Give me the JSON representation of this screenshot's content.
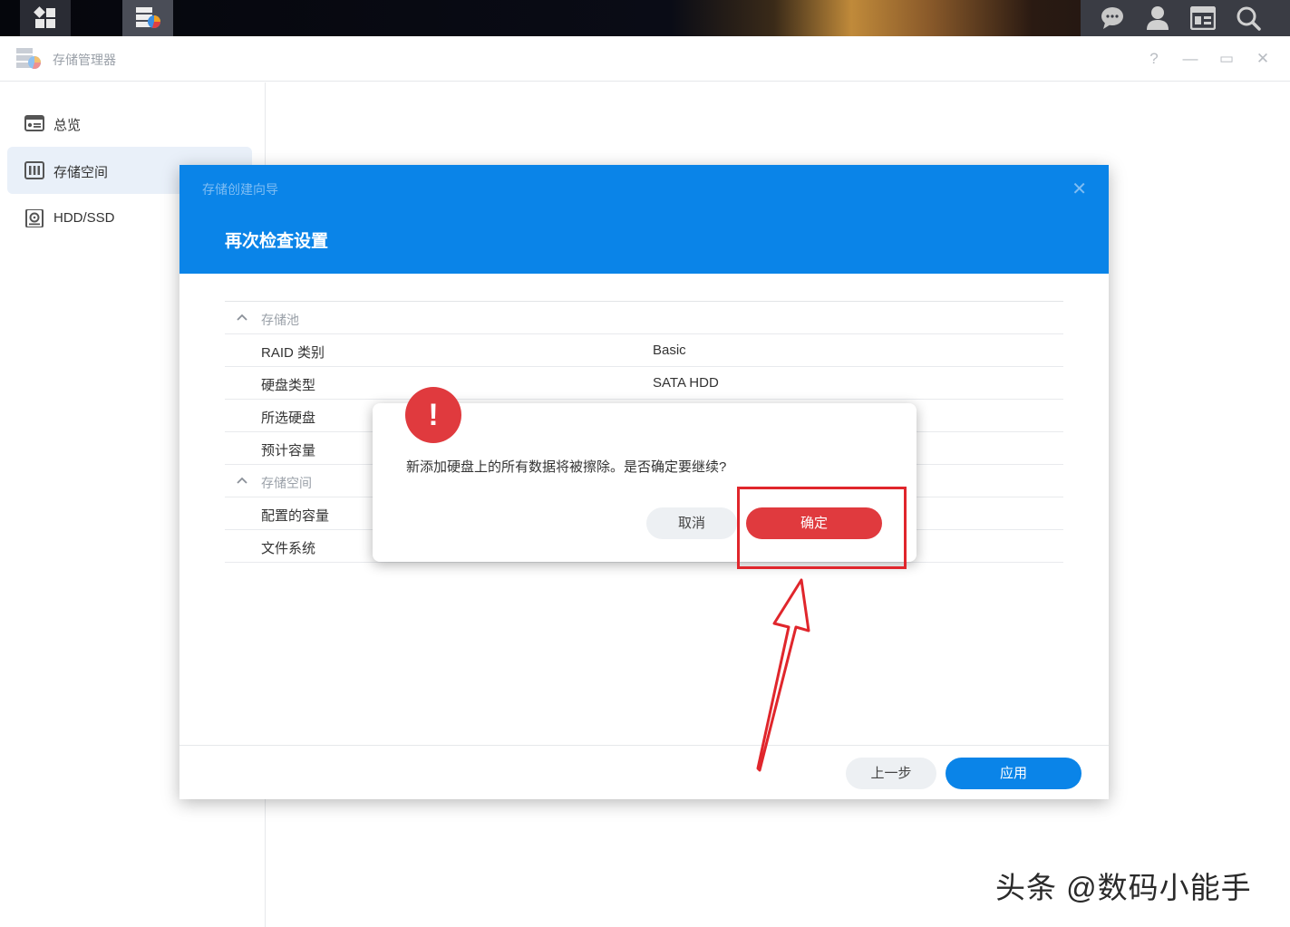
{
  "app": {
    "title": "存储管理器"
  },
  "window_controls": {
    "help": "?",
    "minimize": "—",
    "restore": "▭",
    "close": "✕"
  },
  "sidebar": {
    "items": [
      {
        "label": "总览",
        "icon": "overview-icon"
      },
      {
        "label": "存储空间",
        "icon": "storage-icon",
        "active": true
      },
      {
        "label": "HDD/SSD",
        "icon": "disk-icon"
      }
    ]
  },
  "wizard": {
    "subtitle": "存储创建向导",
    "title": "再次检查设置",
    "close": "✕",
    "sections": [
      {
        "title": "存储池",
        "rows": [
          {
            "key": "RAID 类别",
            "value": "Basic"
          },
          {
            "key": "硬盘类型",
            "value": "SATA HDD"
          },
          {
            "key": "所选硬盘",
            "value": ""
          },
          {
            "key": "预计容量",
            "value": ""
          }
        ]
      },
      {
        "title": "存储空间",
        "rows": [
          {
            "key": "配置的容量",
            "value": ""
          },
          {
            "key": "文件系统",
            "value": ""
          }
        ]
      }
    ],
    "prev_label": "上一步",
    "apply_label": "应用"
  },
  "confirm": {
    "badge": "!",
    "message": "新添加硬盘上的所有数据将被擦除。是否确定要继续?",
    "cancel_label": "取消",
    "ok_label": "确定"
  },
  "watermark": "头条 @数码小能手",
  "colors": {
    "accent": "#0a84e8",
    "danger": "#e03a3e",
    "annotation": "#e0262c"
  }
}
